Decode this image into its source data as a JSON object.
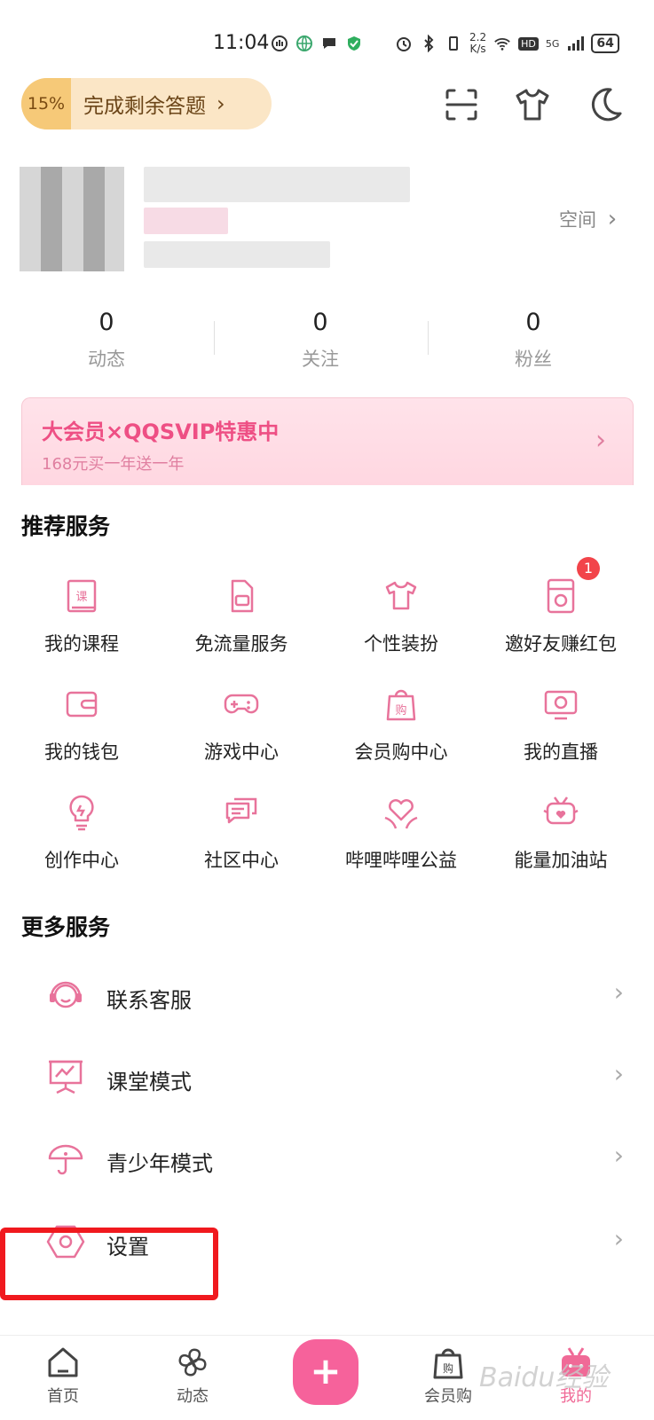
{
  "status_bar": {
    "time": "11:04",
    "net_speed_top": "2.2",
    "net_speed_bottom": "K/s",
    "signal": "5G",
    "hd": "HD",
    "battery": "64"
  },
  "header": {
    "quiz_percent": "15%",
    "quiz_text": "完成剩余答题"
  },
  "profile": {
    "space_label": "空间"
  },
  "stats": [
    {
      "value": "0",
      "label": "动态"
    },
    {
      "value": "0",
      "label": "关注"
    },
    {
      "value": "0",
      "label": "粉丝"
    }
  ],
  "vip_banner": {
    "title": "大会员×QQSVIP特惠中",
    "subtitle": "168元买一年送一年"
  },
  "recommended": {
    "title": "推荐服务",
    "items": [
      {
        "label": "我的课程",
        "icon": "course-icon"
      },
      {
        "label": "免流量服务",
        "icon": "sim-card-icon"
      },
      {
        "label": "个性装扮",
        "icon": "tshirt-icon"
      },
      {
        "label": "邀好友赚红包",
        "icon": "red-envelope-icon",
        "badge": "1"
      },
      {
        "label": "我的钱包",
        "icon": "wallet-icon"
      },
      {
        "label": "游戏中心",
        "icon": "gamepad-icon"
      },
      {
        "label": "会员购中心",
        "icon": "shopping-bag-icon"
      },
      {
        "label": "我的直播",
        "icon": "live-tv-icon"
      },
      {
        "label": "创作中心",
        "icon": "lightbulb-icon"
      },
      {
        "label": "社区中心",
        "icon": "chat-icon"
      },
      {
        "label": "哔哩哔哩公益",
        "icon": "heart-hands-icon"
      },
      {
        "label": "能量加油站",
        "icon": "tv-heart-icon"
      }
    ]
  },
  "more_services": {
    "title": "更多服务",
    "items": [
      {
        "label": "联系客服",
        "icon": "headset-icon"
      },
      {
        "label": "课堂模式",
        "icon": "presentation-icon"
      },
      {
        "label": "青少年模式",
        "icon": "umbrella-icon"
      },
      {
        "label": "设置",
        "icon": "settings-hex-icon"
      }
    ]
  },
  "bottom_nav": [
    {
      "label": "首页",
      "icon": "home-icon"
    },
    {
      "label": "动态",
      "icon": "pinwheel-icon"
    },
    {
      "label": "会员购",
      "icon": "shopping-bag-icon"
    },
    {
      "label": "我的",
      "icon": "tv-mascot-icon"
    }
  ],
  "watermark": "Baidu经验",
  "colors": {
    "accent": "#f06a97",
    "icon_pink": "#e8739b",
    "highlight_red": "#f0191e"
  }
}
